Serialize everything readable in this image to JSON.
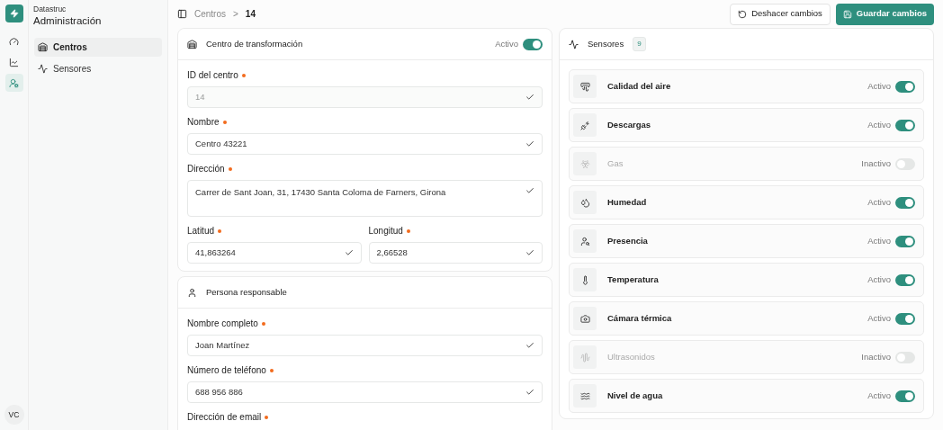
{
  "brand": {
    "company": "Datastruc",
    "section": "Administración"
  },
  "rail": [
    {
      "selected": false
    },
    {
      "selected": false
    },
    {
      "selected": true
    }
  ],
  "user_initials": "VC",
  "nav": [
    {
      "label": "Centros",
      "selected": true
    },
    {
      "label": "Sensores",
      "selected": false
    }
  ],
  "breadcrumb": {
    "parent": "Centros",
    "separator": ">",
    "current": "14"
  },
  "actions": {
    "undo": "Deshacer cambios",
    "save": "Guardar cambios"
  },
  "center_card": {
    "title": "Centro de transformación",
    "status": "Activo",
    "on": true,
    "rows": [
      [
        {
          "label": "ID del centro",
          "required": true,
          "value": "14",
          "disabled": true,
          "kind": "input"
        }
      ],
      [
        {
          "label": "Nombre",
          "required": true,
          "value": "Centro 43221",
          "disabled": false,
          "kind": "input"
        }
      ],
      [
        {
          "label": "Dirección",
          "required": true,
          "value": "Carrer de Sant Joan, 31, 17430 Santa Coloma de Farners, Girona",
          "disabled": false,
          "kind": "textarea"
        }
      ],
      [
        {
          "label": "Latitud",
          "required": true,
          "value": "41,863264",
          "disabled": false,
          "kind": "input"
        },
        {
          "label": "Longitud",
          "required": true,
          "value": "2,66528",
          "disabled": false,
          "kind": "input"
        }
      ]
    ]
  },
  "person_card": {
    "title": "Persona responsable",
    "rows": [
      [
        {
          "label": "Nombre completo",
          "required": true,
          "value": "Joan Martínez",
          "disabled": false,
          "kind": "input"
        }
      ],
      [
        {
          "label": "Número de teléfono",
          "required": true,
          "value": "688 956 886",
          "disabled": false,
          "kind": "input"
        }
      ],
      [
        {
          "label": "Dirección de email",
          "required": true,
          "kind": "label_only"
        }
      ]
    ]
  },
  "sensors_card": {
    "title": "Sensores",
    "count": "9",
    "sensors": [
      {
        "name": "Calidad del aire",
        "status": "Activo",
        "on": true
      },
      {
        "name": "Descargas",
        "status": "Activo",
        "on": true
      },
      {
        "name": "Gas",
        "status": "Inactivo",
        "on": false
      },
      {
        "name": "Humedad",
        "status": "Activo",
        "on": true
      },
      {
        "name": "Presencia",
        "status": "Activo",
        "on": true
      },
      {
        "name": "Temperatura",
        "status": "Activo",
        "on": true
      },
      {
        "name": "Cámara térmica",
        "status": "Activo",
        "on": true
      },
      {
        "name": "Ultrasonidos",
        "status": "Inactivo",
        "on": false
      },
      {
        "name": "Nivel de agua",
        "status": "Activo",
        "on": true
      }
    ]
  }
}
